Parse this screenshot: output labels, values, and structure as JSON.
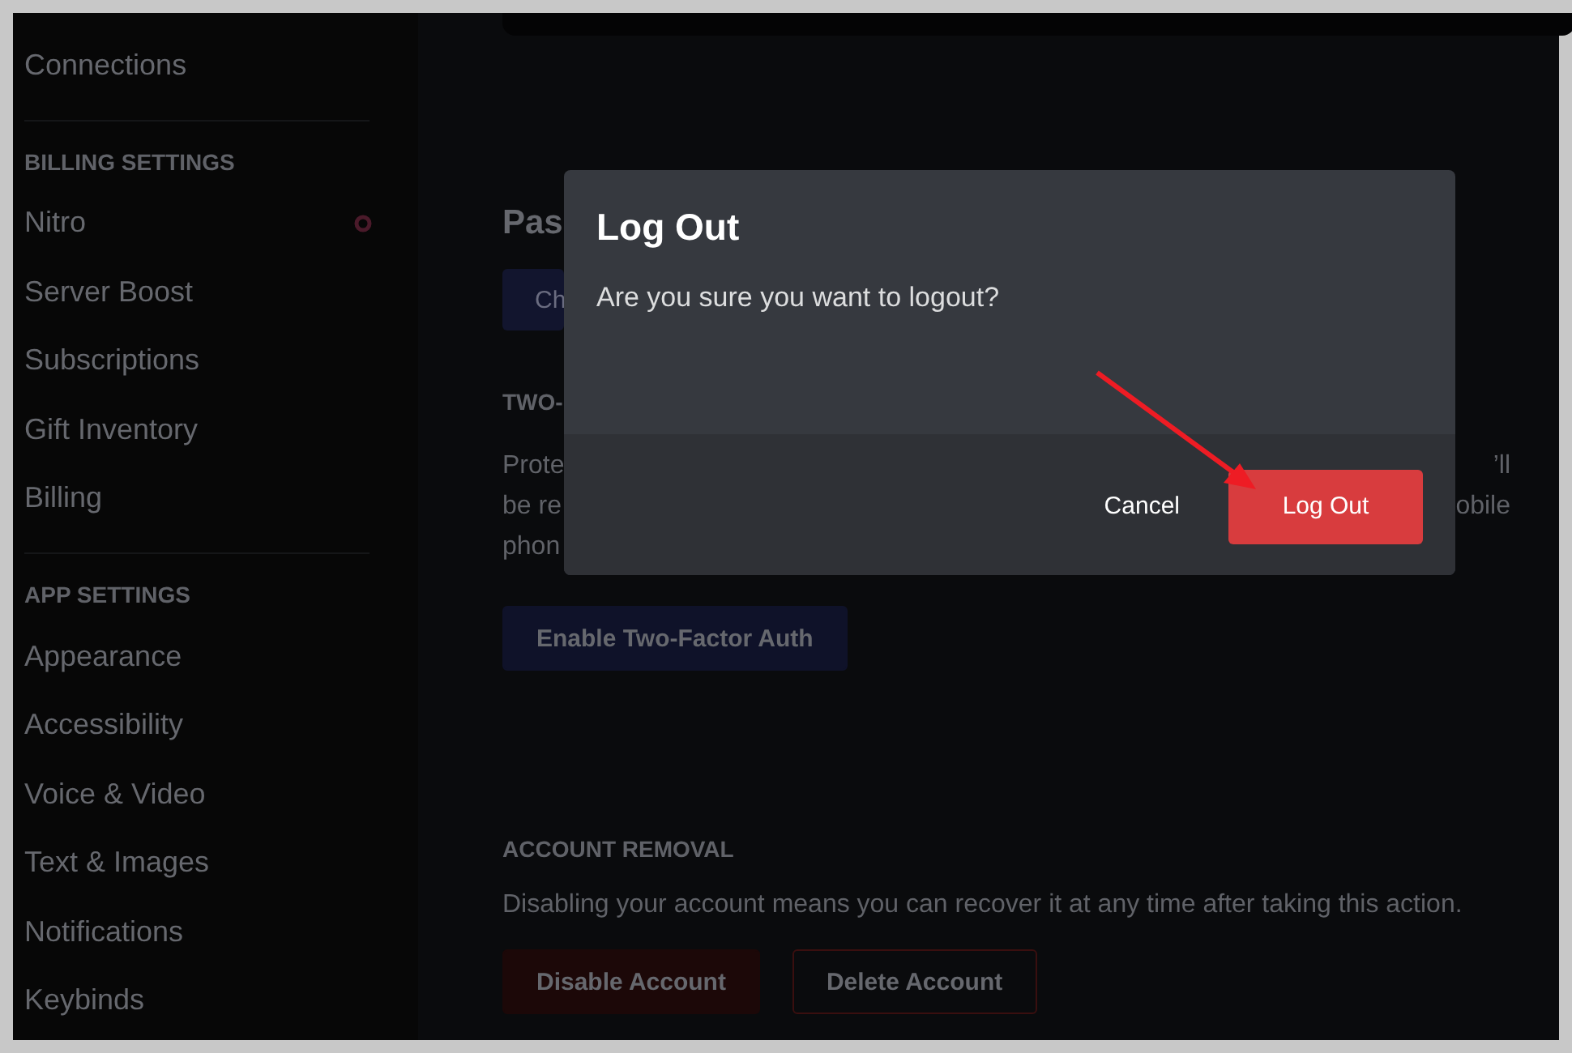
{
  "sidebar": {
    "sections": [
      {
        "items": [
          {
            "label": "Connections",
            "badge": false
          }
        ]
      },
      {
        "header": "BILLING SETTINGS",
        "items": [
          {
            "label": "Nitro",
            "badge": true
          },
          {
            "label": "Server Boost",
            "badge": false
          },
          {
            "label": "Subscriptions",
            "badge": false
          },
          {
            "label": "Gift Inventory",
            "badge": false
          },
          {
            "label": "Billing",
            "badge": false
          }
        ]
      },
      {
        "header": "APP SETTINGS",
        "items": [
          {
            "label": "Appearance",
            "badge": false
          },
          {
            "label": "Accessibility",
            "badge": false
          },
          {
            "label": "Voice & Video",
            "badge": false
          },
          {
            "label": "Text & Images",
            "badge": false
          },
          {
            "label": "Notifications",
            "badge": false
          },
          {
            "label": "Keybinds",
            "badge": false
          }
        ]
      }
    ]
  },
  "settings": {
    "heading": "Pas",
    "heading_button": "Ch",
    "two_factor_label": "TWO-",
    "two_factor_lines": [
      {
        "left": "Prote",
        "right": "’ll"
      },
      {
        "left": "be re",
        "right": "obile"
      },
      {
        "left": "phon"
      }
    ],
    "two_factor_button": "Enable Two-Factor Auth",
    "removal_label": "ACCOUNT REMOVAL",
    "removal_text": "Disabling your account means you can recover it at any time after taking this action.",
    "removal_buttons": [
      {
        "label": "Disable Account",
        "kind": "filled"
      },
      {
        "label": "Delete Account",
        "kind": "outline"
      }
    ]
  },
  "dialog": {
    "title": "Log Out",
    "message": "Are you sure you want to logout?",
    "buttons": [
      {
        "label": "Cancel",
        "kind": "link"
      },
      {
        "label": "Log Out",
        "kind": "danger"
      }
    ]
  }
}
